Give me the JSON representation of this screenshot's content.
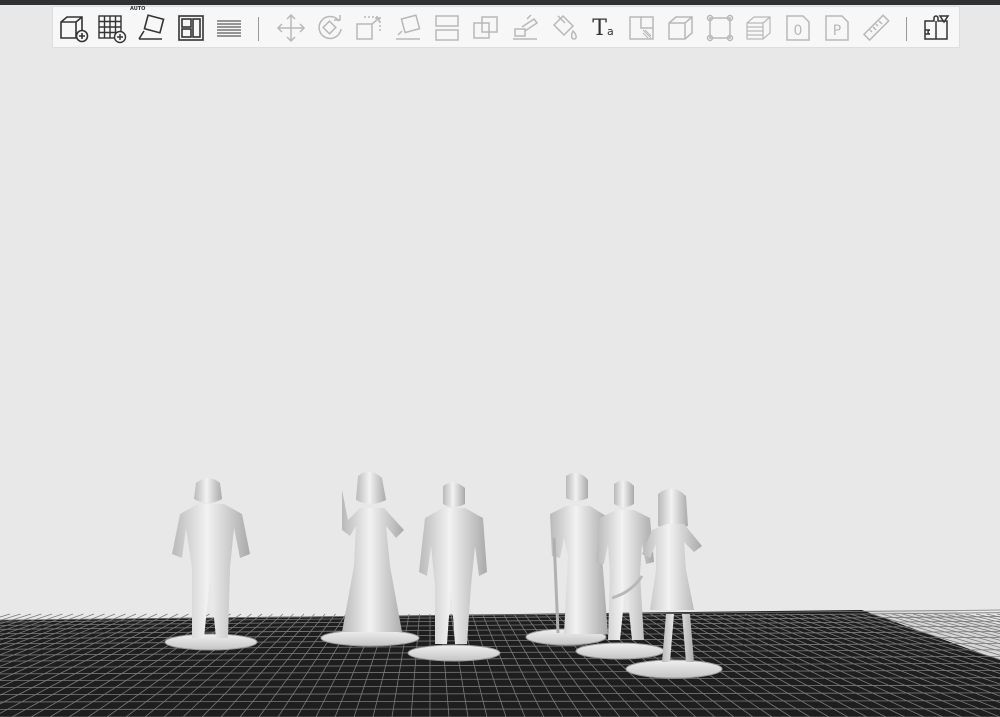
{
  "toolbar": {
    "tools": [
      {
        "name": "add-object",
        "icon": "cube-plus-icon",
        "state": "active"
      },
      {
        "name": "add-plate",
        "icon": "grid-plus-icon",
        "state": "active"
      },
      {
        "name": "auto-orient",
        "icon": "auto-orient-icon",
        "state": "active",
        "label": "AUTO"
      },
      {
        "name": "arrange",
        "icon": "arrange-icon",
        "state": "active"
      },
      {
        "name": "layers",
        "icon": "layers-icon",
        "state": "active"
      },
      {
        "name": "move",
        "icon": "move-icon",
        "state": "inactive"
      },
      {
        "name": "rotate",
        "icon": "rotate-icon",
        "state": "inactive"
      },
      {
        "name": "scale",
        "icon": "scale-icon",
        "state": "inactive"
      },
      {
        "name": "lay-on-face",
        "icon": "lay-flat-icon",
        "state": "inactive"
      },
      {
        "name": "cut",
        "icon": "cut-icon",
        "state": "inactive"
      },
      {
        "name": "boolean",
        "icon": "boolean-icon",
        "state": "inactive"
      },
      {
        "name": "support-paint",
        "icon": "support-paint-icon",
        "state": "inactive"
      },
      {
        "name": "color-paint",
        "icon": "paint-bucket-icon",
        "state": "inactive"
      },
      {
        "name": "text",
        "icon": "text-icon",
        "state": "active",
        "label": "T",
        "sublabel": "a"
      },
      {
        "name": "seam-paint",
        "icon": "seam-icon",
        "state": "inactive"
      },
      {
        "name": "measure-box",
        "icon": "box-icon",
        "state": "inactive"
      },
      {
        "name": "assemble",
        "icon": "assemble-icon",
        "state": "inactive"
      },
      {
        "name": "slice-layers",
        "icon": "stack-icon",
        "state": "inactive"
      },
      {
        "name": "brim-ear",
        "icon": "zero-icon",
        "state": "inactive",
        "label": "0"
      },
      {
        "name": "variable-height",
        "icon": "p-icon",
        "state": "inactive",
        "label": "P"
      },
      {
        "name": "measure",
        "icon": "ruler-icon",
        "state": "inactive"
      },
      {
        "name": "split-parts",
        "icon": "split-icon",
        "state": "active"
      }
    ]
  }
}
